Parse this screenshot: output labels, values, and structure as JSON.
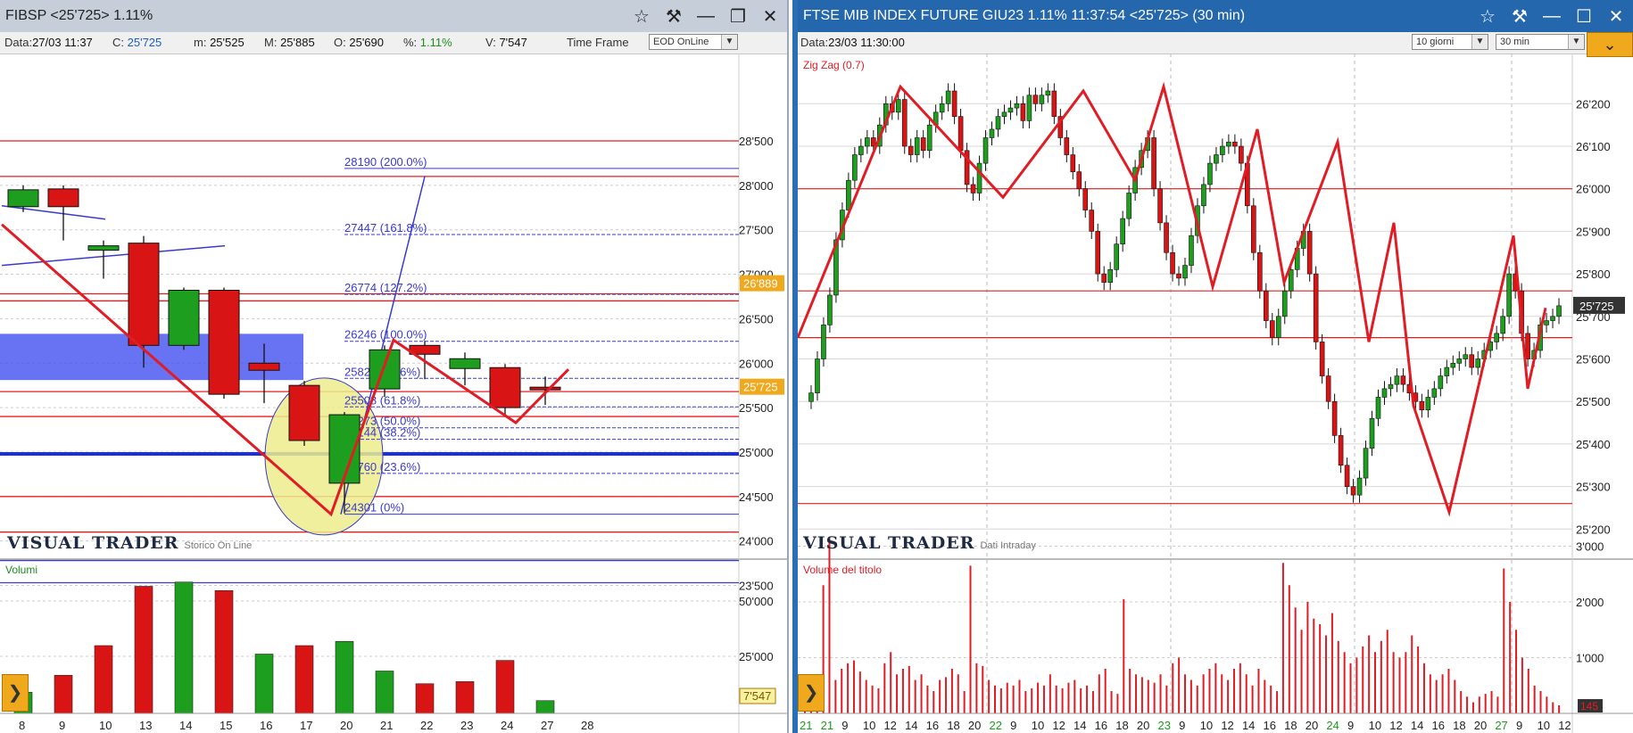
{
  "left": {
    "title": "FIBSP <25'725> 1.11%",
    "info": {
      "data_label": "Data:",
      "data_value": "27/03 11:37",
      "c_label": "C:",
      "c_value": "25'725",
      "m_label": "m:",
      "m_value": "25'525",
      "M_label": "M:",
      "M_value": "25'885",
      "O_label": "O:",
      "O_value": "25'690",
      "pct_label": "%:",
      "pct_value": "1.11%",
      "v_label": "V:",
      "v_value": "7'547",
      "timeframe_label": "Time Frame",
      "timeframe_value": "EOD OnLine"
    },
    "brand": "VISUAL TRADER",
    "brand_sub": "Storico On Line",
    "volume_label": "Volumi",
    "current_price_label": "25'725",
    "marker_price_label": "26'889",
    "volume_value_label": "7'547",
    "price_axis": [
      "28'500",
      "28'000",
      "27'500",
      "27'000",
      "26'500",
      "26'000",
      "25'500",
      "25'000",
      "24'500",
      "24'000",
      "23'500"
    ],
    "volume_axis": [
      "50'000",
      "25'000"
    ],
    "x_labels": [
      "8",
      "9",
      "10",
      "13",
      "14",
      "15",
      "16",
      "17",
      "20",
      "21",
      "22",
      "23",
      "24",
      "27",
      "28"
    ],
    "fib_levels": [
      {
        "label": "28190 (200.0%)"
      },
      {
        "label": "27447 (161.8%)"
      },
      {
        "label": "26774 (127.2%)"
      },
      {
        "label": "26246 (100.0%)"
      },
      {
        "label": "25829 (76.6%)"
      },
      {
        "label": "25508 (61.8%)"
      },
      {
        "label": "25273 (50.0%)"
      },
      {
        "label": "25144 (38.2%)"
      },
      {
        "label": "24760 (23.6%)"
      },
      {
        "label": "24301 (0%)"
      }
    ],
    "candles": [
      {
        "o": 27950,
        "h": 28000,
        "l": 27700,
        "c": 27760,
        "color": "green"
      },
      {
        "o": 27960,
        "h": 28000,
        "l": 27380,
        "c": 27760,
        "color": "red"
      },
      {
        "o": 27320,
        "h": 27380,
        "l": 26950,
        "c": 27270,
        "color": "green"
      },
      {
        "o": 27350,
        "h": 27430,
        "l": 25950,
        "c": 26200,
        "color": "red"
      },
      {
        "o": 26200,
        "h": 26850,
        "l": 26150,
        "c": 26820,
        "color": "green"
      },
      {
        "o": 26820,
        "h": 26850,
        "l": 25600,
        "c": 25650,
        "color": "red"
      },
      {
        "o": 26000,
        "h": 26220,
        "l": 25550,
        "c": 25920,
        "color": "red"
      },
      {
        "o": 25750,
        "h": 25800,
        "l": 25070,
        "c": 25130,
        "color": "red"
      },
      {
        "o": 24650,
        "h": 25450,
        "l": 24310,
        "c": 25420,
        "color": "green"
      },
      {
        "o": 25710,
        "h": 26200,
        "l": 25620,
        "c": 26150,
        "color": "green"
      },
      {
        "o": 26200,
        "h": 26250,
        "l": 25820,
        "c": 26100,
        "color": "red"
      },
      {
        "o": 25940,
        "h": 26120,
        "l": 25750,
        "c": 26050,
        "color": "green"
      },
      {
        "o": 25950,
        "h": 25990,
        "l": 25420,
        "c": 25500,
        "color": "red"
      },
      {
        "o": 25730,
        "h": 25850,
        "l": 25530,
        "c": 25725,
        "color": "neutral"
      }
    ],
    "volumes": [
      {
        "v": 5,
        "color": "green"
      },
      {
        "v": 9,
        "color": "red"
      },
      {
        "v": 16,
        "color": "red"
      },
      {
        "v": 30,
        "color": "red"
      },
      {
        "v": 31,
        "color": "green"
      },
      {
        "v": 29,
        "color": "red"
      },
      {
        "v": 14,
        "color": "green"
      },
      {
        "v": 16,
        "color": "red"
      },
      {
        "v": 17,
        "color": "green"
      },
      {
        "v": 10,
        "color": "green"
      },
      {
        "v": 7,
        "color": "red"
      },
      {
        "v": 7.5,
        "color": "red"
      },
      {
        "v": 12.5,
        "color": "red"
      },
      {
        "v": 3,
        "color": "green"
      }
    ]
  },
  "right": {
    "title": "FTSE MIB INDEX FUTURE GIU23 1.11% 11:37:54  <25'725> (30 min)",
    "data_label": "Data:",
    "data_value": "23/03 11:30:00",
    "period_value": "10 giorni",
    "interval_value": "30 min",
    "indicator_label": "Zig Zag (0.7)",
    "brand": "VISUAL TRADER",
    "brand_sub": "Dati Intraday",
    "volume_label": "Volume del titolo",
    "current_price_label": "25'725",
    "volume_value_label": "145",
    "price_axis": [
      "26'200",
      "26'100",
      "26'000",
      "25'900",
      "25'800",
      "25'700",
      "25'600",
      "25'500",
      "25'400",
      "25'300",
      "25'200"
    ],
    "volume_axis": [
      "3'000",
      "2'000",
      "1'000"
    ],
    "x_labels": [
      {
        "t": "21",
        "day": true
      },
      {
        "t": "21",
        "day": true
      },
      {
        "t": "9",
        "day": false
      },
      {
        "t": "10",
        "day": false
      },
      {
        "t": "12",
        "day": false
      },
      {
        "t": "14",
        "day": false
      },
      {
        "t": "16",
        "day": false
      },
      {
        "t": "18",
        "day": false
      },
      {
        "t": "20",
        "day": false
      },
      {
        "t": "22",
        "day": true
      },
      {
        "t": "9",
        "day": false
      },
      {
        "t": "10",
        "day": false
      },
      {
        "t": "12",
        "day": false
      },
      {
        "t": "14",
        "day": false
      },
      {
        "t": "16",
        "day": false
      },
      {
        "t": "18",
        "day": false
      },
      {
        "t": "20",
        "day": false
      },
      {
        "t": "23",
        "day": true
      },
      {
        "t": "9",
        "day": false
      },
      {
        "t": "10",
        "day": false
      },
      {
        "t": "12",
        "day": false
      },
      {
        "t": "14",
        "day": false
      },
      {
        "t": "16",
        "day": false
      },
      {
        "t": "18",
        "day": false
      },
      {
        "t": "20",
        "day": false
      },
      {
        "t": "24",
        "day": true
      },
      {
        "t": "9",
        "day": false
      },
      {
        "t": "10",
        "day": false
      },
      {
        "t": "12",
        "day": false
      },
      {
        "t": "14",
        "day": false
      },
      {
        "t": "16",
        "day": false
      },
      {
        "t": "18",
        "day": false
      },
      {
        "t": "20",
        "day": false
      },
      {
        "t": "27",
        "day": true
      },
      {
        "t": "9",
        "day": false
      },
      {
        "t": "10",
        "day": false
      },
      {
        "t": "12",
        "day": false
      }
    ],
    "zigzag": [
      25650,
      26240,
      25980,
      26230,
      26020,
      26240,
      25770,
      26140,
      25780,
      26110,
      25640,
      25920,
      25490,
      25240,
      25890,
      25530,
      25720
    ],
    "price_path": [
      25500,
      25520,
      25600,
      25680,
      25750,
      25880,
      25950,
      26020,
      26080,
      26100,
      26120,
      26100,
      26150,
      26200,
      26180,
      26210,
      26100,
      26080,
      26120,
      26090,
      26150,
      26180,
      26200,
      26230,
      26170,
      26090,
      26010,
      25990,
      26060,
      26120,
      26140,
      26170,
      26180,
      26190,
      26200,
      26160,
      26220,
      26200,
      26220,
      26230,
      26170,
      26120,
      26080,
      26040,
      26000,
      25950,
      25900,
      25800,
      25780,
      25810,
      25870,
      25930,
      25990,
      26050,
      26090,
      26120,
      26000,
      25920,
      25850,
      25800,
      25790,
      25820,
      25890,
      25960,
      26010,
      26060,
      26080,
      26100,
      26110,
      26100,
      26060,
      25960,
      25850,
      25760,
      25690,
      25650,
      25700,
      25760,
      25810,
      25860,
      25900,
      25800,
      25640,
      25560,
      25500,
      25420,
      25350,
      25300,
      25280,
      25320,
      25390,
      25460,
      25510,
      25530,
      25540,
      25560,
      25540,
      25520,
      25500,
      25480,
      25510,
      25530,
      25560,
      25580,
      25590,
      25600,
      25610,
      25580,
      25600,
      25620,
      25640,
      25660,
      25700,
      25800,
      25760,
      25660,
      25600,
      25620,
      25680,
      25690,
      25700,
      25725
    ],
    "volumes": [
      200,
      250,
      180,
      2300,
      3150,
      600,
      800,
      900,
      950,
      750,
      600,
      500,
      450,
      900,
      1100,
      700,
      800,
      850,
      600,
      700,
      500,
      400,
      600,
      650,
      800,
      700,
      400,
      2650,
      900,
      850,
      600,
      500,
      450,
      550,
      500,
      600,
      400,
      450,
      550,
      500,
      700,
      500,
      450,
      550,
      600,
      450,
      500,
      400,
      700,
      800,
      400,
      350,
      2050,
      800,
      700,
      650,
      600,
      550,
      700,
      500,
      900,
      1000,
      700,
      600,
      500,
      700,
      800,
      900,
      700,
      600,
      800,
      900,
      700,
      500,
      800,
      600,
      500,
      400,
      2700,
      2300,
      1900,
      1500,
      2000,
      1700,
      1600,
      1400,
      1800,
      1300,
      1100,
      900,
      1000,
      1200,
      1400,
      1100,
      1300,
      1500,
      1100,
      1000,
      1100,
      1400,
      1200,
      900,
      700,
      600,
      700,
      800,
      600,
      400,
      300,
      200,
      300,
      350,
      400,
      300,
      2600,
      2000,
      1500,
      1000,
      800,
      500,
      400,
      300,
      200,
      145
    ]
  },
  "colors": {
    "up": "#1e9e1e",
    "down": "#d81414",
    "zigzag": "#e01c24",
    "fib": "#3a3acb",
    "accent": "#f0a81c",
    "title_right": "#2467ad"
  },
  "icons": [
    "star-icon",
    "pin-icon",
    "minimize-icon",
    "restore-icon",
    "close-icon",
    "maximize-icon",
    "chevron-down-icon",
    "chevron-right-icon"
  ]
}
